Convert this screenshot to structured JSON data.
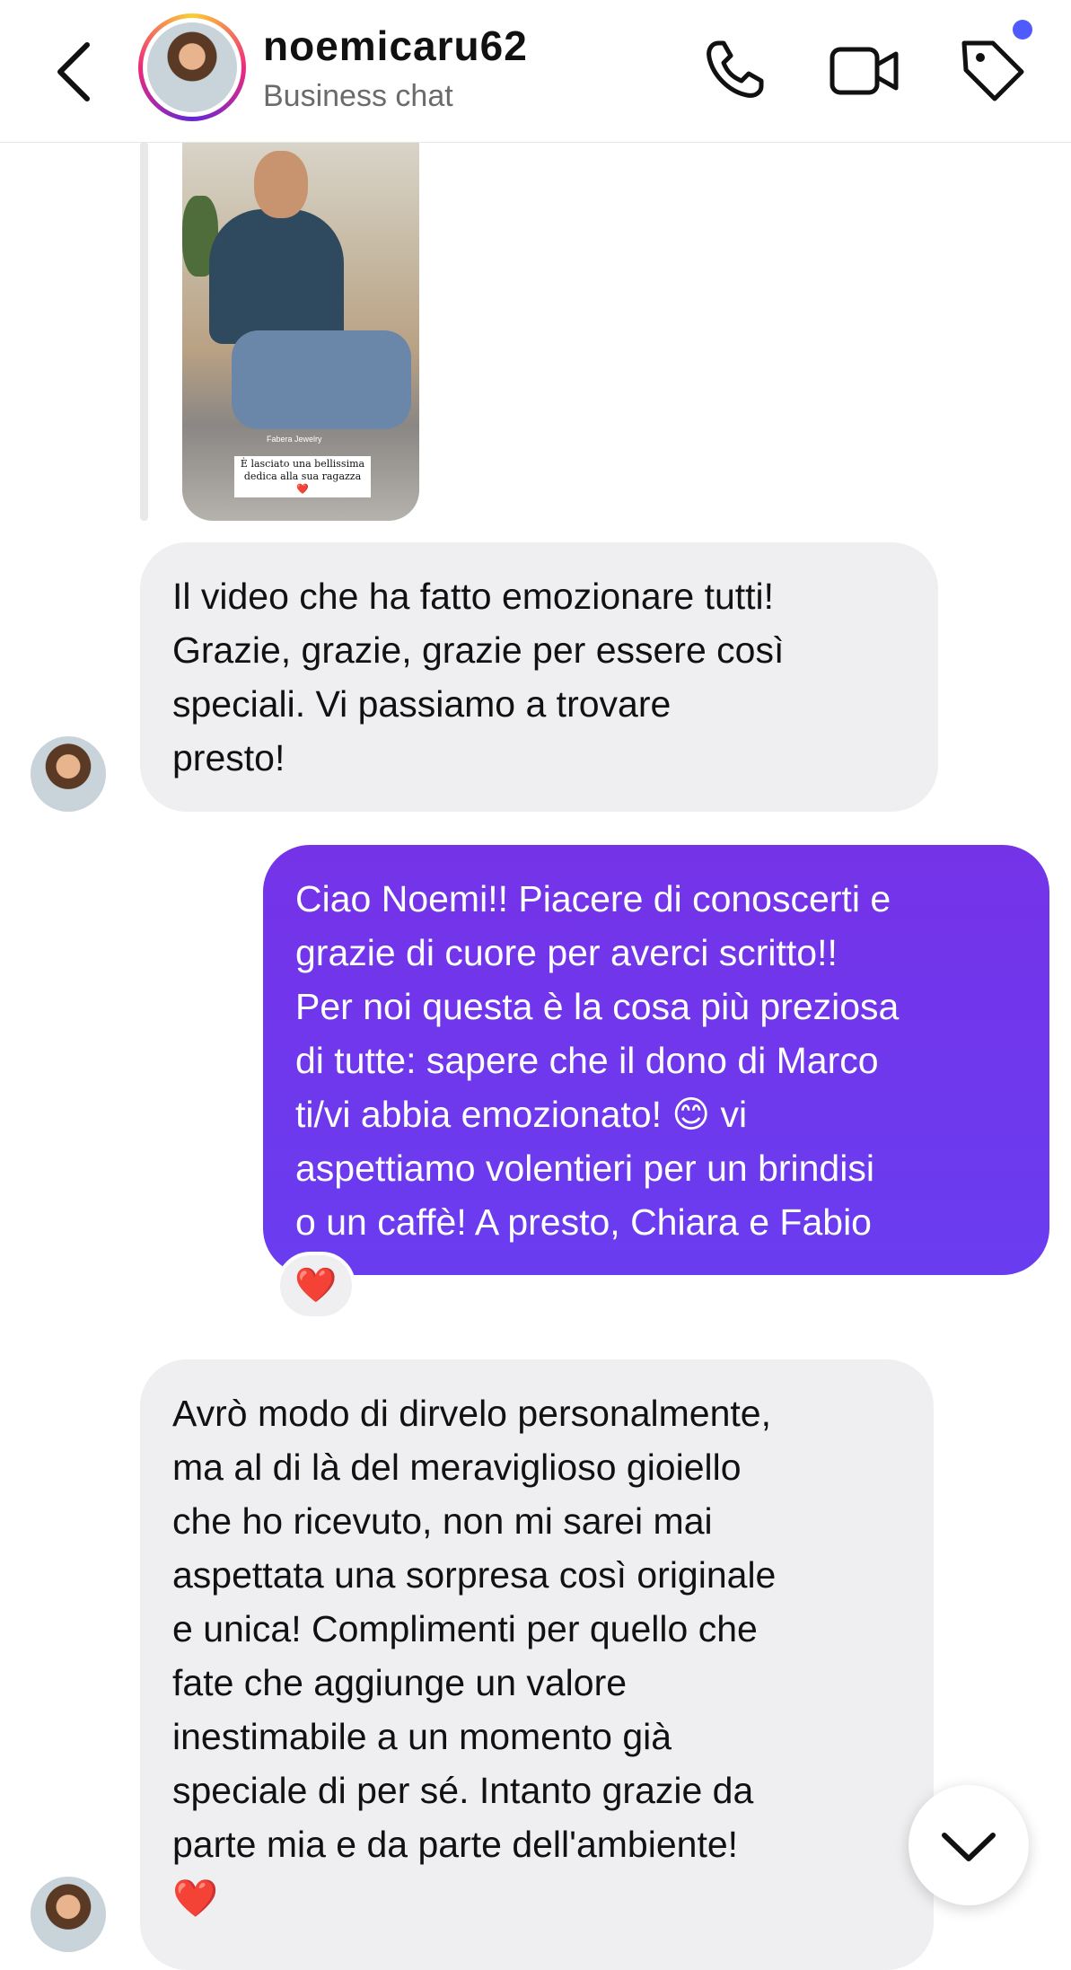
{
  "header": {
    "username": "noemicaru62",
    "subtitle": "Business chat"
  },
  "shared_media": {
    "location_tag": "Fabera Jewelry",
    "caption": "È lasciato una bellissima dedica alla sua ragazza ❤️"
  },
  "messages": [
    {
      "direction": "incoming",
      "lines": [
        "Il video che ha fatto emozionare tutti!",
        "Grazie, grazie, grazie per essere così",
        "speciali. Vi passiamo a trovare",
        "presto!"
      ]
    },
    {
      "direction": "outgoing",
      "lines": [
        "Ciao Noemi!! Piacere di conoscerti e",
        "grazie di cuore per averci scritto!!",
        "Per noi questa è la cosa più preziosa",
        "di tutte: sapere che il dono di Marco",
        "ti/vi abbia emozionato! 😊 vi",
        "aspettiamo volentieri per un brindisi",
        "o un caffè! A presto, Chiara e Fabio"
      ],
      "reaction": "❤️"
    },
    {
      "direction": "incoming",
      "lines": [
        "Avrò modo di dirvelo personalmente,",
        "ma al di là del meraviglioso gioiello",
        "che ho ricevuto, non mi sarei mai",
        "aspettata una sorpresa così originale",
        "e unica! Complimenti per quello che",
        "fate che aggiunge un valore",
        "inestimabile a un momento già",
        "speciale di per sé. Intanto grazie da",
        "parte mia e da parte dell'ambiente!",
        "❤️"
      ]
    }
  ],
  "colors": {
    "outgoing_bubble": "#6d34ea",
    "incoming_bubble": "#efeff1",
    "notification_dot": "#4f5bff",
    "heart": "#e0253a"
  },
  "icons": {
    "back": "chevron-left-icon",
    "call": "phone-icon",
    "video": "video-camera-icon",
    "tag": "tag-icon",
    "scroll_down": "chevron-down-icon"
  }
}
